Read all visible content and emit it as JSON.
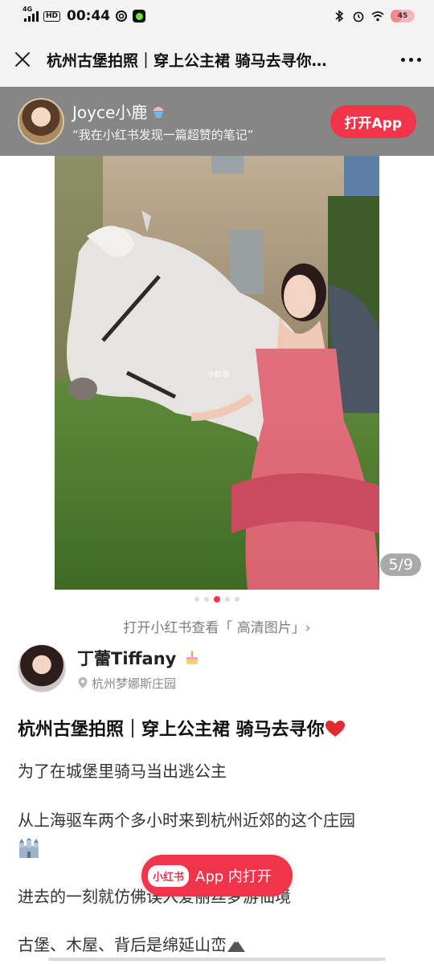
{
  "status_bar": {
    "network": "4G",
    "hd": "HD",
    "time": "00:44",
    "battery": "45",
    "battery_level": 0.45
  },
  "title_bar": {
    "title": "杭州古堡拍照｜穿上公主裙 骑马去寻你…"
  },
  "banner": {
    "sharer_name": "Joyce小鹿",
    "quote": "“我在小红书发现一篇超赞的笔记”",
    "open_app_label": "打开App"
  },
  "gallery": {
    "counter": "5/9",
    "current": 5,
    "total": 9,
    "watermark": "小红书",
    "dots_visible": 5,
    "dots_active_index": 2
  },
  "hd_link": "打开小红书查看「 高清图片」›",
  "author": {
    "name": "丁蕾Tiffany",
    "location": "杭州梦娜斯庄园"
  },
  "note": {
    "title": "杭州古堡拍照｜穿上公主裙 骑马去寻你",
    "paragraphs": [
      "为了在城堡里骑马当出逃公主",
      "从上海驱车两个多小时来到杭州近郊的这个庄园",
      "进去的一刻就仿佛误入爱丽丝梦游仙境",
      "古堡、木屋、背后是绵延山峦"
    ]
  },
  "float_button": {
    "logo": "小红书",
    "label": "App 内打开"
  },
  "colors": {
    "accent": "#f2344b",
    "banner_bg": "#868686",
    "bar_bg": "#f3f3f3"
  }
}
